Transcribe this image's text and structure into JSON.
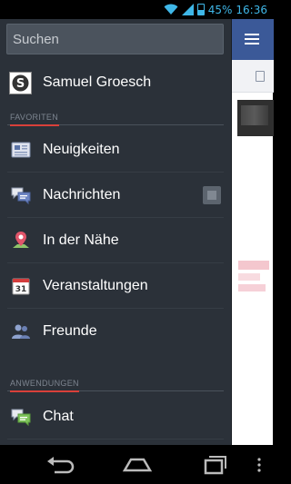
{
  "status_bar": {
    "battery_percent": "45%",
    "battery_level": 0.45,
    "time": "16:36",
    "accent_color": "#3fb7e8"
  },
  "search": {
    "placeholder": "Suchen"
  },
  "profile": {
    "name": "Samuel Groesch"
  },
  "sections": {
    "favorites": "FAVORITEN",
    "apps": "ANWENDUNGEN"
  },
  "menu": {
    "items": [
      {
        "label": "Neuigkeiten",
        "icon": "news-feed-icon"
      },
      {
        "label": "Nachrichten",
        "icon": "messages-icon"
      },
      {
        "label": "In der Nähe",
        "icon": "location-pin-icon"
      },
      {
        "label": "Veranstaltungen",
        "icon": "calendar-icon",
        "icon_text": "31"
      },
      {
        "label": "Freunde",
        "icon": "friends-icon"
      }
    ],
    "apps": [
      {
        "label": "Chat",
        "icon": "chat-icon"
      }
    ]
  },
  "colors": {
    "sidebar_bg": "#2b3139",
    "brand_blue": "#3b5998",
    "section_underline": "#d9403a"
  }
}
